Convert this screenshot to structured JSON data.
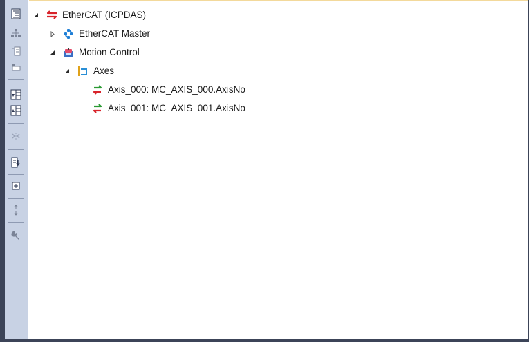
{
  "tree": {
    "root": {
      "label": "EtherCAT (ICPDAS)",
      "expanded": true,
      "icon": "ethercat-arrows-icon"
    },
    "items": [
      {
        "label": "EtherCAT Master",
        "expanded": false,
        "icon": "ethercat-master-icon"
      },
      {
        "label": "Motion Control",
        "expanded": true,
        "icon": "motion-control-icon"
      },
      {
        "label": "Axes",
        "expanded": true,
        "icon": "axes-icon"
      },
      {
        "label": "Axis_000: MC_AXIS_000.AxisNo",
        "icon": "axis-link-icon"
      },
      {
        "label": "Axis_001: MC_AXIS_001.AxisNo",
        "icon": "axis-link-icon"
      }
    ]
  },
  "toolbar": {
    "buttons": [
      "tree-view-icon",
      "network-icon",
      "properties-icon",
      "device-icon",
      "import-icon",
      "export-icon",
      "disconnect-icon",
      "download-icon",
      "add-icon",
      "sort-icon",
      "wrench-icon"
    ]
  },
  "colors": {
    "accent_red": "#d8232a",
    "accent_green": "#2a9a33",
    "toolbar_bg": "#c8d2e4",
    "frame": "#3c4458"
  }
}
